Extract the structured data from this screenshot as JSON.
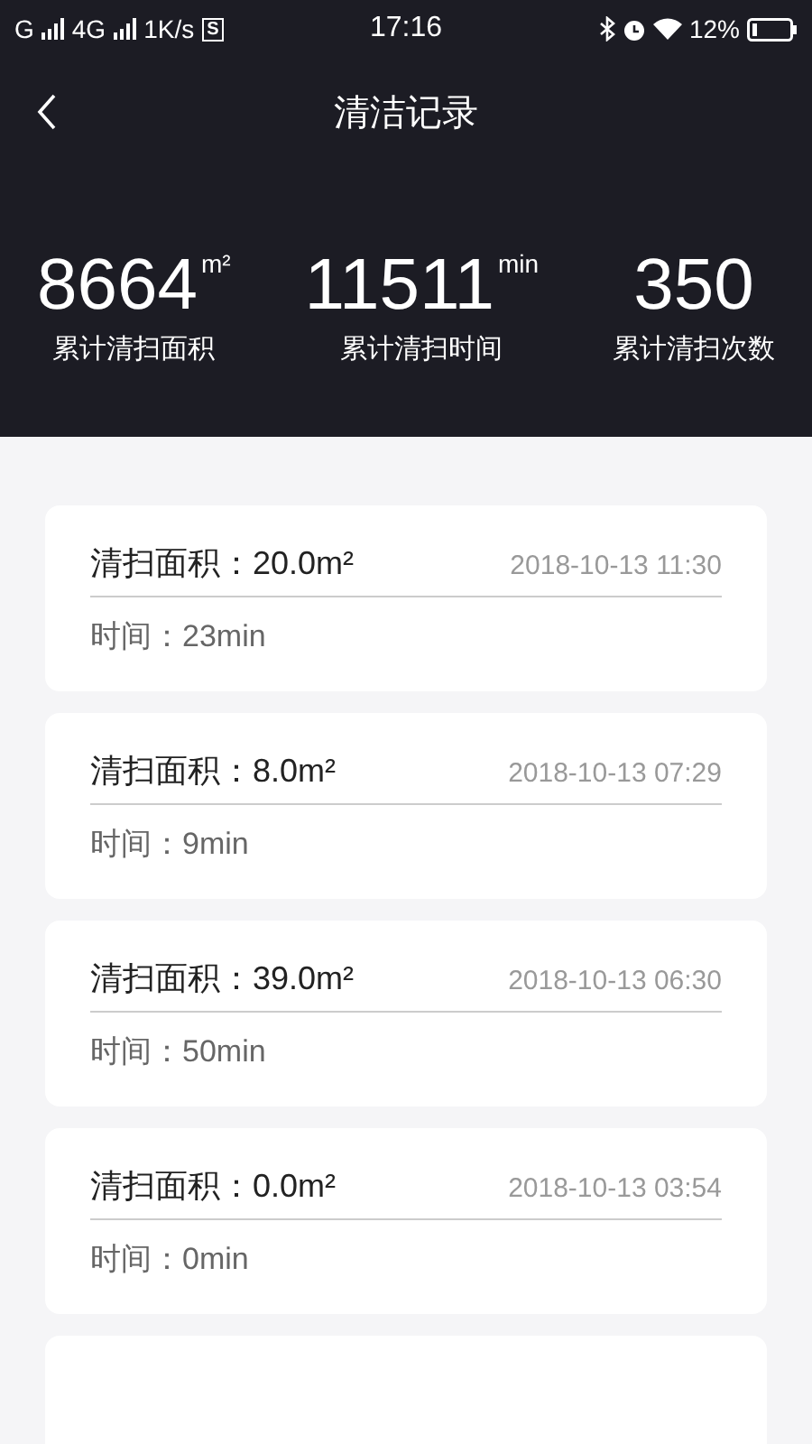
{
  "status_bar": {
    "network_1": "G",
    "network_2": "4G",
    "speed": "1K/s",
    "sim_badge": "S",
    "time": "17:16",
    "battery": "12%"
  },
  "header": {
    "title": "清洁记录"
  },
  "stats": [
    {
      "value": "8664",
      "unit": "m²",
      "label": "累计清扫面积"
    },
    {
      "value": "11511",
      "unit": "min",
      "label": "累计清扫时间"
    },
    {
      "value": "350",
      "label": "累计清扫次数"
    }
  ],
  "records": [
    {
      "area": "清扫面积：20.0m²",
      "date": "2018-10-13 11:30",
      "duration": "时间：23min"
    },
    {
      "area": "清扫面积：8.0m²",
      "date": "2018-10-13 07:29",
      "duration": "时间：9min"
    },
    {
      "area": "清扫面积：39.0m²",
      "date": "2018-10-13 06:30",
      "duration": "时间：50min"
    },
    {
      "area": "清扫面积：0.0m²",
      "date": "2018-10-13 03:54",
      "duration": "时间：0min"
    }
  ],
  "more_records_below": true
}
